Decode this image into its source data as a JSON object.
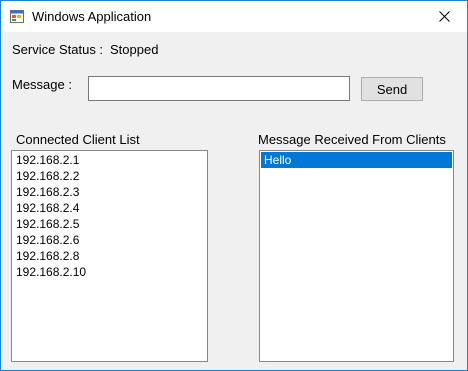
{
  "window": {
    "title": "Windows Application",
    "close_glyph": "✕"
  },
  "status": {
    "label": "Service Status :",
    "value": "Stopped"
  },
  "message": {
    "label": "Message :",
    "value": "",
    "send_label": "Send"
  },
  "clients": {
    "label": "Connected Client List",
    "items": [
      "192.168.2.1",
      "192.168.2.2",
      "192.168.2.3",
      "192.168.2.4",
      "192.168.2.5",
      "192.168.2.6",
      "192.168.2.8",
      "192.168.2.10"
    ]
  },
  "received": {
    "label": "Message Received From Clients",
    "items": [
      "Hello"
    ],
    "selected_index": 0
  },
  "colors": {
    "selection": "#0078d7",
    "window_border": "#1883d7",
    "background": "#f0f0f0"
  },
  "icons": {
    "app": "app-window-icon",
    "close": "close-icon"
  }
}
